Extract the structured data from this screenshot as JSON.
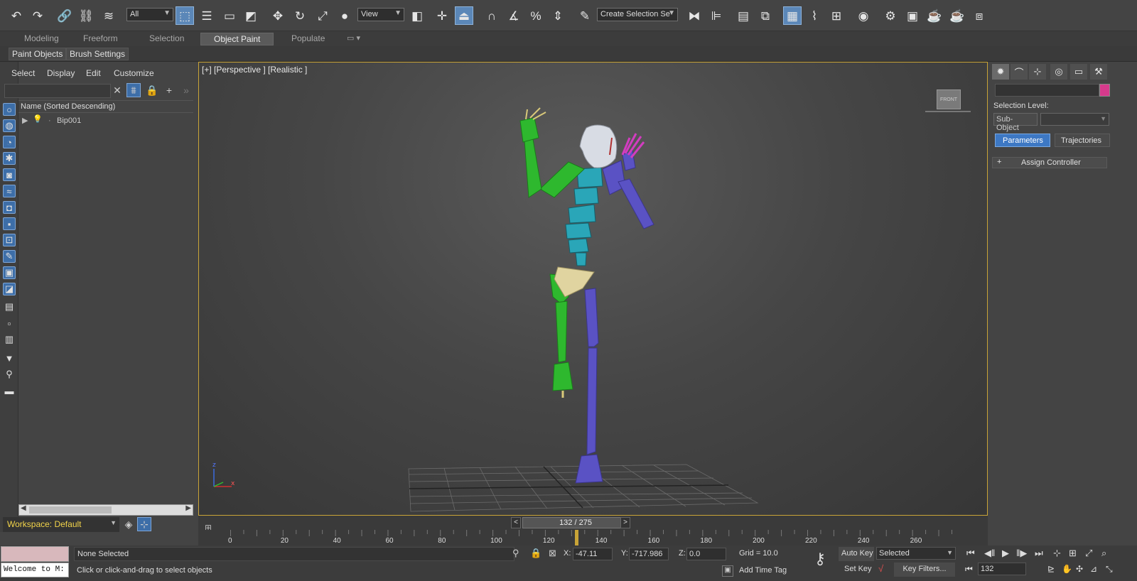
{
  "toolbar": {
    "selection_filter": "All",
    "reference_coord": "View",
    "named_selection_placeholder": "Create Selection Se"
  },
  "ribbon": {
    "tabs": [
      "Modeling",
      "Freeform",
      "Selection",
      "Object Paint",
      "Populate"
    ],
    "active_tab": "Object Paint",
    "sub_buttons": [
      "Paint Objects",
      "Brush Settings"
    ]
  },
  "scene_explorer": {
    "menus": [
      "Select",
      "Display",
      "Edit",
      "Customize"
    ],
    "column_header": "Name (Sorted Descending)",
    "items": [
      {
        "name": "Bip001"
      }
    ],
    "workspace": "Workspace: Default"
  },
  "viewport": {
    "label": "[+] [Perspective ] [Realistic ]",
    "viewcube_label": "FRONT",
    "axis_x": "x",
    "axis_z": "z"
  },
  "command_panel": {
    "selection_level_label": "Selection Level:",
    "sub_object_label": "Sub-Object",
    "tabs": [
      "Parameters",
      "Trajectories"
    ],
    "active_tab": "Parameters",
    "assign_controller": "Assign Controller",
    "object_color": "#d63a8c"
  },
  "timeline": {
    "frame_display": "132 / 275",
    "current_frame": 132,
    "total_frames": 275,
    "tick_labels": [
      "0",
      "20",
      "40",
      "60",
      "80",
      "100",
      "120",
      "140",
      "160",
      "180",
      "200",
      "220",
      "240",
      "260"
    ]
  },
  "status": {
    "maxscript_listener": "Welcome to M:",
    "selection_status": "None Selected",
    "prompt": "Click or click-and-drag to select objects",
    "x_label": "X:",
    "x_value": "-47.11",
    "y_label": "Y:",
    "y_value": "-717.986",
    "z_label": "Z:",
    "z_value": "0.0",
    "grid": "Grid = 10.0",
    "add_time_tag": "Add Time Tag",
    "auto_key": "Auto Key",
    "set_key": "Set Key",
    "key_mode": "Selected",
    "key_filters": "Key Filters...",
    "frame_spinner": "132"
  }
}
